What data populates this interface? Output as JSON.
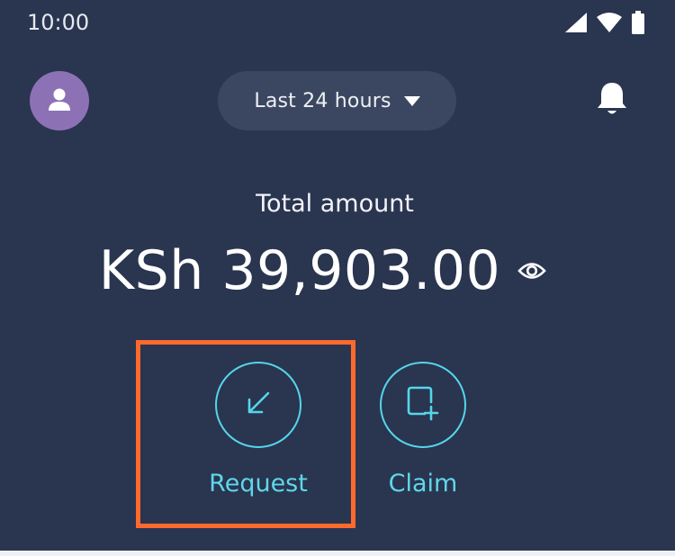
{
  "status_bar": {
    "time": "10:00",
    "icons": [
      "cellular-signal-icon",
      "wifi-icon",
      "battery-icon"
    ]
  },
  "header": {
    "avatar_icon": "user-icon",
    "period_selector": {
      "selected": "Last 24 hours",
      "icon": "caret-down-icon"
    },
    "notifications_icon": "bell-icon"
  },
  "balance": {
    "label": "Total amount",
    "amount": "KSh 39,903.00",
    "visibility_icon": "eye-icon"
  },
  "actions": [
    {
      "label": "Request",
      "icon": "arrow-down-left-icon",
      "highlighted": true
    },
    {
      "label": "Claim",
      "icon": "document-plus-icon",
      "highlighted": false
    }
  ],
  "colors": {
    "background": "#2a3550",
    "pill": "#3b4761",
    "avatar": "#8c72b5",
    "accent": "#55d6ea",
    "highlight": "#ff6a2c"
  }
}
